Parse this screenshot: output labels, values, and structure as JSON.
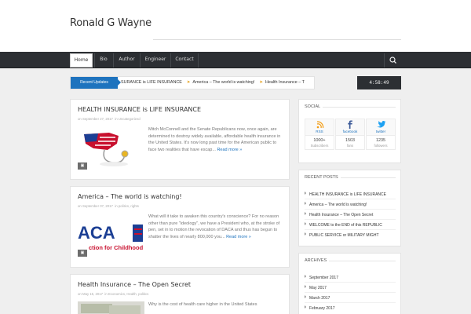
{
  "site": {
    "title": "Ronald G Wayne"
  },
  "nav": {
    "items": [
      {
        "label": "Home",
        "active": true
      },
      {
        "label": "Bio",
        "active": false
      },
      {
        "label": "Author",
        "active": false,
        "has_dropdown": true
      },
      {
        "label": "Engineer",
        "active": false
      },
      {
        "label": "Contact",
        "active": false
      }
    ],
    "search_icon": "search-icon"
  },
  "ticker": {
    "label": "Recent Updates",
    "items": [
      "SURANCE is LIFE INSURANCE",
      "America – The world is watching!",
      "Health Insurance – T"
    ]
  },
  "clock": "4:58:49",
  "posts": [
    {
      "title": "HEALTH INSURANCE is LIFE INSURANCE",
      "date": "September 27, 2017",
      "categories": "Uncategorized",
      "excerpt": "Mitch McConnell and the Senate Republicans now, once again, are determined to destroy widely available, affordable health insurance in the United States. It's now long past time for the American public to face two realities that have escap...",
      "read_more": "Read more »",
      "thumb": "us-map-stethoscope-image"
    },
    {
      "title": "America – The world is watching!",
      "date": "September 07, 2017",
      "categories": "politics, rights",
      "excerpt": "What will it take to awaken this country's conscience? For no reason other than pure \"ideology\", we have a President who, at the stroke of pen, set in to motion the revocation of DACA and thus has begun to shatter the lives of nearly 800,000 you...",
      "read_more": "Read more »",
      "thumb": "daca-sign-image",
      "thumb_text_big": "ACA",
      "thumb_text_small": "ction for Childhood /"
    },
    {
      "title": "Health Insurance – The Open Secret",
      "date": "May 15, 2017",
      "categories": "Economics, Health, politics",
      "excerpt": "Why is the cost of health care higher in the United States",
      "read_more": "",
      "thumb": "money-image"
    }
  ],
  "sidebar": {
    "social": {
      "title": "SOCIAL",
      "boxes": [
        {
          "icon": "rss-icon",
          "name": "RSS",
          "count": "1000+",
          "unit": "Subscribers",
          "color": "#f39c12"
        },
        {
          "icon": "facebook-icon",
          "name": "facebook",
          "count": "1503",
          "unit": "fans",
          "color": "#3b5998"
        },
        {
          "icon": "twitter-icon",
          "name": "twitter",
          "count": "1235",
          "unit": "followers",
          "color": "#1da1f2"
        }
      ]
    },
    "recent_posts": {
      "title": "RECENT POSTS",
      "items": [
        "HEALTH INSURANCE is LIFE INSURANCE",
        "America – The world is watching!",
        "Health Insurance – The Open Secret",
        "WELCOME to the END of this REPUBLIC",
        "PUBLIC SERVICE or MILITARY MIGHT"
      ]
    },
    "archives": {
      "title": "ARCHIVES",
      "items": [
        "September 2017",
        "May 2017",
        "March 2017",
        "February 2017"
      ]
    }
  },
  "colors": {
    "accent": "#1e73be",
    "nav_bg": "#2c2f33",
    "page_bg": "#efefef"
  }
}
